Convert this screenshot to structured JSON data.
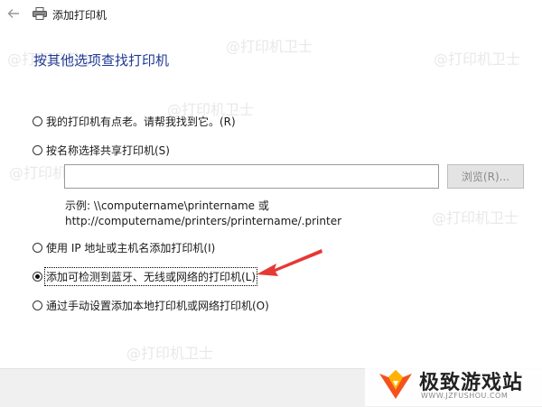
{
  "window": {
    "title": "添加打印机",
    "icon": "printer-icon",
    "back": "back-arrow-icon"
  },
  "heading": "按其他选项查找打印机",
  "options": [
    {
      "label": "我的打印机有点老。请帮我找到它。(R)",
      "checked": false
    },
    {
      "label": "按名称选择共享打印机(S)",
      "checked": false
    },
    {
      "label": "使用 IP 地址或主机名添加打印机(I)",
      "checked": false
    },
    {
      "label": "添加可检测到蓝牙、无线或网络的打印机(L)",
      "checked": true
    },
    {
      "label": "通过手动设置添加本地打印机或网络打印机(O)",
      "checked": false
    }
  ],
  "share_input": {
    "value": "",
    "placeholder": ""
  },
  "browse_label": "浏览(R)...",
  "example": {
    "line1": "示例: \\\\computername\\printername 或",
    "line2": "http://computername/printers/printername/.printer"
  },
  "watermark": "@打印机卫士",
  "logo": {
    "text": "极致游戏站",
    "url": "WWW.JZFUSHOU.COM"
  },
  "colors": {
    "heading": "#1f3a93",
    "annotation_arrow": "#e53935",
    "footer": "#f0f0f0"
  }
}
